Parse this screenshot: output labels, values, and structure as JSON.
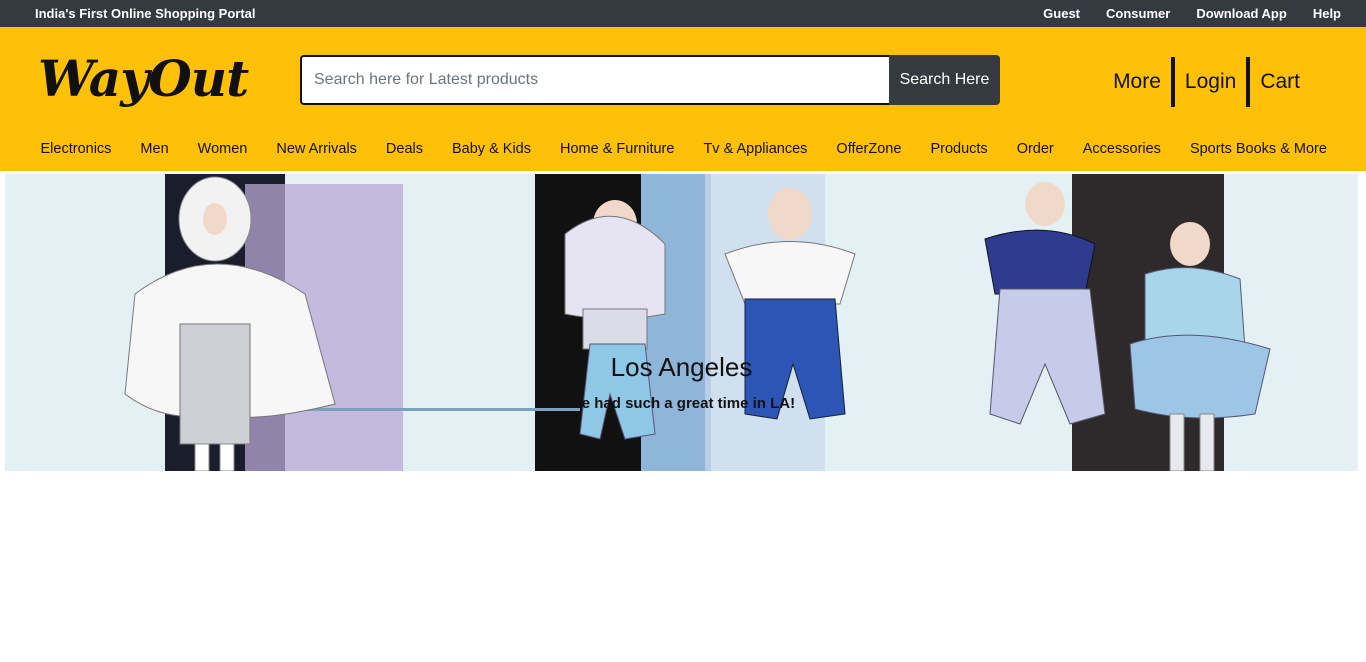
{
  "topbar": {
    "tagline": "India's First Online Shopping Portal",
    "links": [
      "Guest",
      "Consumer",
      "Download App",
      "Help"
    ]
  },
  "header": {
    "logo": "WayOut",
    "search": {
      "placeholder": "Search here for Latest products",
      "value": "",
      "button": "Search Here"
    },
    "account": {
      "more": "More",
      "login": "Login",
      "cart": "Cart"
    }
  },
  "categories": [
    "Electronics",
    "Men",
    "Women",
    "New Arrivals",
    "Deals",
    "Baby & Kids",
    "Home & Furniture",
    "Tv & Appliances",
    "OfferZone",
    "Products",
    "Order",
    "Accessories",
    "Sports Books & More"
  ],
  "carousel": {
    "title": "Los Angeles",
    "subtitle": "We had such a great time in LA!"
  },
  "colors": {
    "topbar": "#343a40",
    "header": "#ffc107",
    "button": "#343a40"
  }
}
